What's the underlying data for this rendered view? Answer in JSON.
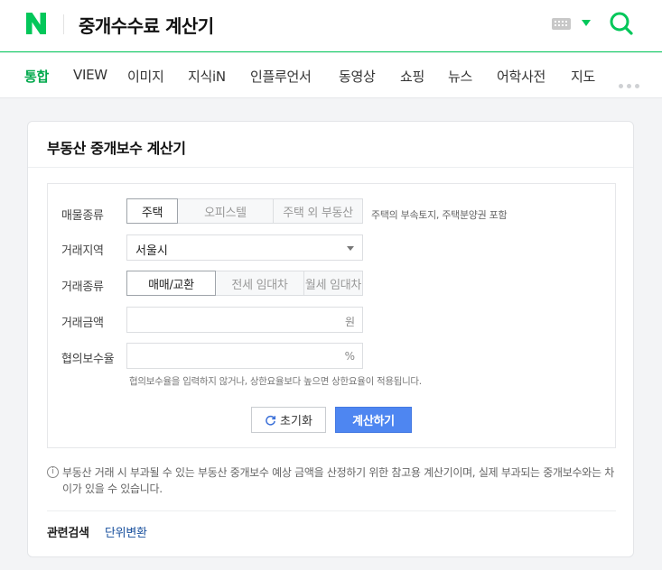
{
  "header": {
    "query": "중개수수료 계산기",
    "brand_color": "#03c75a"
  },
  "tabs": [
    {
      "label": "통합",
      "active": true
    },
    {
      "label": "VIEW"
    },
    {
      "label": "이미지"
    },
    {
      "label": "지식iN"
    },
    {
      "label": "인플루언서"
    },
    {
      "label": "동영상"
    },
    {
      "label": "쇼핑"
    },
    {
      "label": "뉴스"
    },
    {
      "label": "어학사전"
    },
    {
      "label": "지도"
    }
  ],
  "card": {
    "title": "부동산 중개보수 계산기",
    "form": {
      "property_type": {
        "label": "매물종류",
        "options": [
          "주택",
          "오피스텔",
          "주택 외 부동산"
        ],
        "selected": "주택",
        "hint": "주택의 부속토지, 주택분양권 포함"
      },
      "region": {
        "label": "거래지역",
        "value": "서울시"
      },
      "deal_type": {
        "label": "거래종류",
        "options": [
          "매매/교환",
          "전세 임대차",
          "월세 임대차"
        ],
        "selected": "매매/교환"
      },
      "amount": {
        "label": "거래금액",
        "value": "",
        "unit": "원"
      },
      "rate": {
        "label": "협의보수율",
        "value": "",
        "unit": "%",
        "note": "협의보수율을 입력하지 않거나, 상한요율보다 높으면 상한요율이 적용됩니다."
      },
      "reset_label": "초기화",
      "calc_label": "계산하기",
      "calc_color": "#4e86f1"
    },
    "disclaimer": "부동산 거래 시 부과될 수 있는 부동산 중개보수 예상 금액을 산정하기 위한 참고용 계산기이며, 실제 부과되는 중개보수와는 차이가 있을 수 있습니다.",
    "related": {
      "label": "관련검색",
      "link": "단위변환",
      "link_color": "#164e9c"
    }
  }
}
